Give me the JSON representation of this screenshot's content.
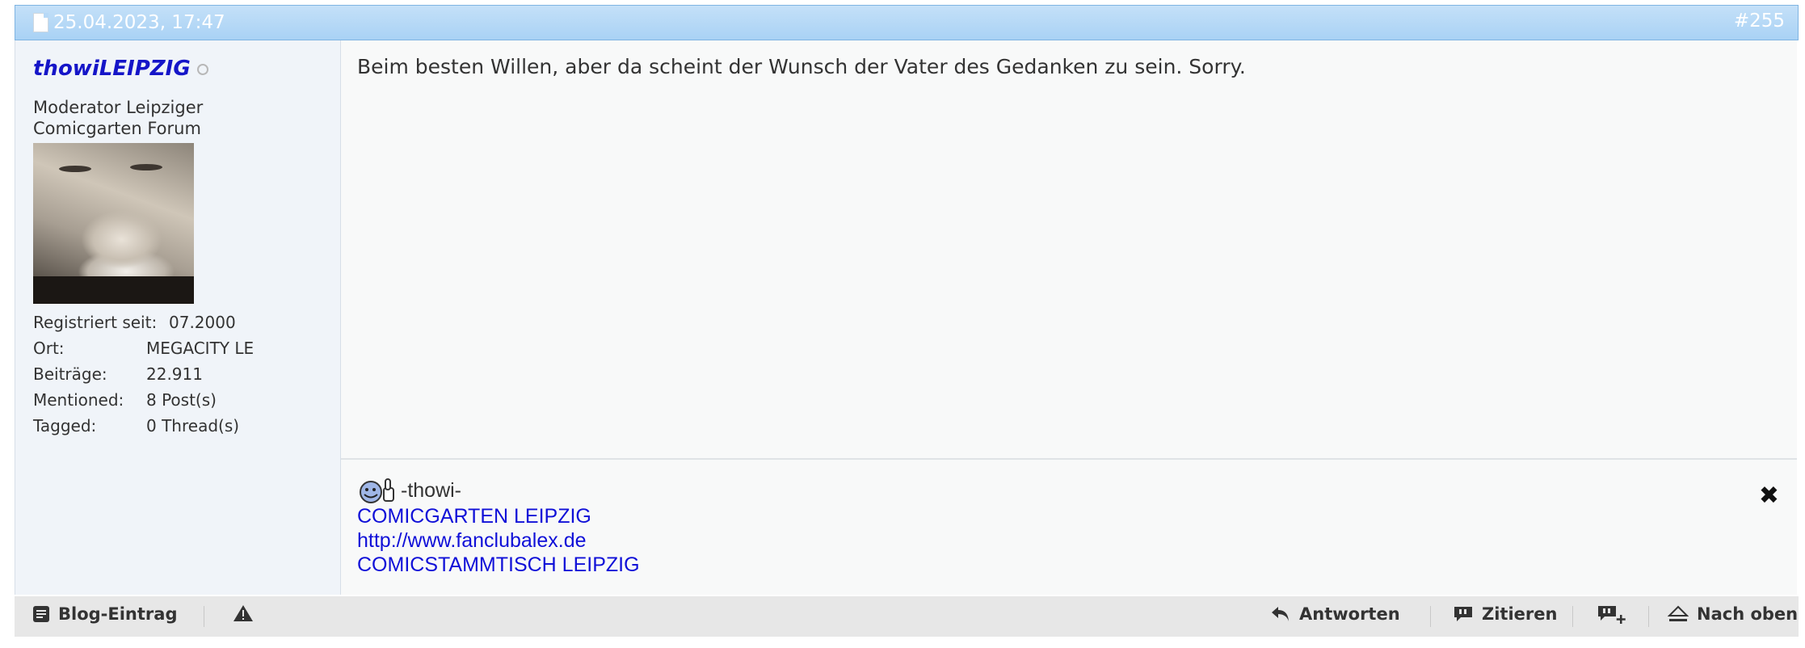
{
  "post": {
    "date": "25.04.2023, 17:47",
    "number": "#255",
    "message": "Beim besten Willen, aber da scheint der Wunsch der Vater des Gedanken zu sein. Sorry."
  },
  "user": {
    "name": "thowiLEIPZIG",
    "title": "Moderator Leipziger Comicgarten Forum",
    "stats": [
      {
        "label": "Registriert seit:",
        "value": "07.2000"
      },
      {
        "label": "Ort:",
        "value": "MEGACITY LE"
      },
      {
        "label": "Beiträge:",
        "value": "22.911"
      },
      {
        "label": "Mentioned:",
        "value": "8 Post(s)"
      },
      {
        "label": "Tagged:",
        "value": "0 Thread(s)"
      }
    ]
  },
  "signature": {
    "name": "-thowi-",
    "links": [
      "COMICGARTEN LEIPZIG",
      "http://www.fanclubalex.de",
      "COMICSTAMMTISCH LEIPZIG"
    ],
    "close": "✖"
  },
  "footer": {
    "blog": "Blog-Eintrag",
    "reply": "Antworten",
    "quote": "Zitieren",
    "top": "Nach oben"
  },
  "colors": {
    "header": "#b5dbf8",
    "username": "#1515c8",
    "link": "#1010d8"
  }
}
